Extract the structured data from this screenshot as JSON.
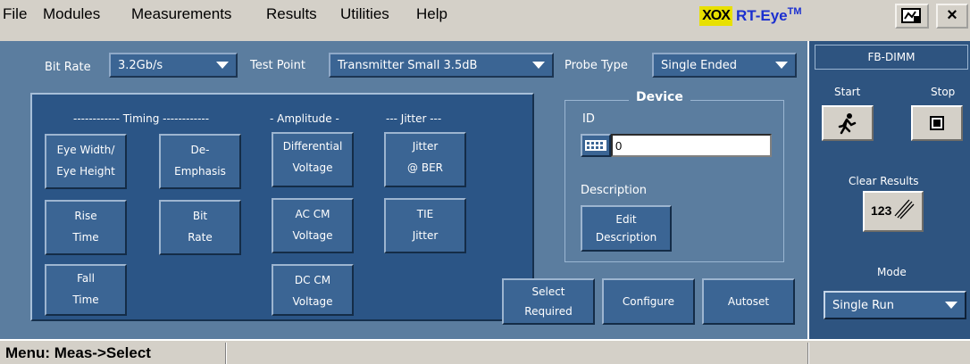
{
  "menu": {
    "file": "File",
    "modules": "Modules",
    "measurements": "Measurements",
    "results": "Results",
    "utilities": "Utilities",
    "help": "Help"
  },
  "brand": {
    "logo_text": "XOX",
    "name": "RT-Eye",
    "tm": "TM"
  },
  "title_buttons": {
    "restore_icon": "window-toggle-icon",
    "close": "×"
  },
  "settings": {
    "bit_rate_label": "Bit Rate",
    "bit_rate_value": "3.2Gb/s",
    "test_point_label": "Test Point",
    "test_point_value": "Transmitter Small 3.5dB",
    "probe_type_label": "Probe Type",
    "probe_type_value": "Single Ended"
  },
  "headers": {
    "timing": "------------ Timing ------------",
    "amplitude": "- Amplitude -",
    "jitter": "--- Jitter ---"
  },
  "measurements": {
    "eye_width": [
      "Eye Width/",
      "Eye Height"
    ],
    "de_emphasis": [
      "De-",
      "Emphasis"
    ],
    "differential_voltage": [
      "Differential",
      "Voltage"
    ],
    "jitter_ber": [
      "Jitter",
      "@ BER"
    ],
    "rise_time": [
      "Rise",
      "Time"
    ],
    "bit_rate": [
      "Bit",
      "Rate"
    ],
    "ac_cm_voltage": [
      "AC CM",
      "Voltage"
    ],
    "tie_jitter": [
      "TIE",
      "Jitter"
    ],
    "fall_time": [
      "Fall",
      "Time"
    ],
    "dc_cm_voltage": [
      "DC CM",
      "Voltage"
    ]
  },
  "device": {
    "title": "Device",
    "id_label": "ID",
    "id_value": "0",
    "description_label": "Description",
    "edit_description": [
      "Edit",
      "Description"
    ]
  },
  "actions": {
    "select_required": [
      "Select",
      "Required"
    ],
    "configure": "Configure",
    "autoset": "Autoset"
  },
  "side": {
    "module": "FB-DIMM",
    "start": "Start",
    "stop": "Stop",
    "clear_results": "Clear Results",
    "clear_icon_text": "123",
    "mode_label": "Mode",
    "mode_value": "Single Run"
  },
  "status": {
    "text": "Menu: Meas->Select"
  },
  "colors": {
    "panel": "#5b7d9f",
    "group": "#2b5586",
    "button": "#3b6594",
    "side": "#2e5480",
    "chrome": "#d4d0c8",
    "brand_blue": "#1b2fd0",
    "brand_yellow": "#e8e000"
  }
}
